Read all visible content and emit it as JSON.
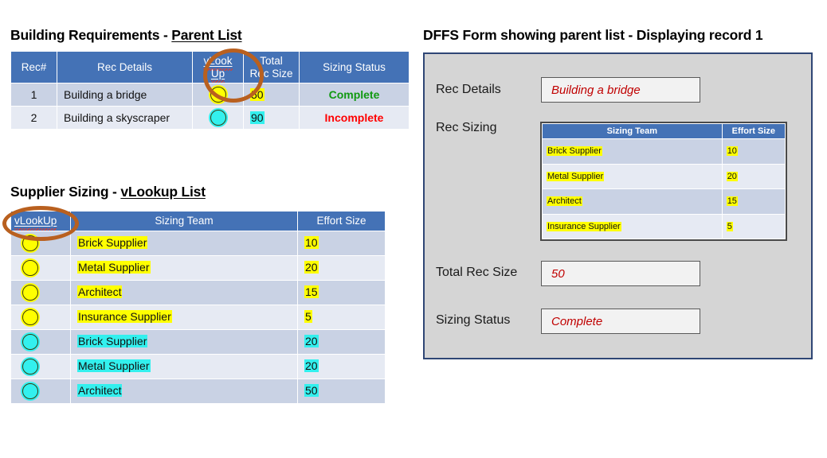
{
  "left": {
    "parent": {
      "title_plain": "Building Requirements - ",
      "title_underlined": "Parent List",
      "title_full": "Building Requirements - Parent List",
      "columns": [
        "Rec#",
        "Rec Details",
        "vLook Up",
        "Total Rec Size",
        "Sizing Status"
      ],
      "col_vlookup_line1": "vLook",
      "col_vlookup_line2": "Up",
      "col_total_line1": "Total",
      "col_total_line2": "Rec Size",
      "rows": [
        {
          "rec": "1",
          "details": "Building a bridge",
          "marker": "circle-yellow",
          "size": "50",
          "size_hl": "yellow",
          "status": "Complete",
          "status_kind": "complete"
        },
        {
          "rec": "2",
          "details": "Building a skyscraper",
          "marker": "circle-cyan",
          "size": "90",
          "size_hl": "cyan",
          "status": "Incomplete",
          "status_kind": "incomplete"
        }
      ]
    },
    "supplier": {
      "title_plain": "Supplier Sizing - ",
      "title_underlined": "vLookup List",
      "title_full": "Supplier Sizing - vLookup List",
      "columns": [
        "vLookUp",
        "Sizing Team",
        "Effort Size"
      ],
      "rows": [
        {
          "marker": "circle-yellow",
          "team": "Brick Supplier",
          "team_hl": "yellow",
          "effort": "10",
          "effort_hl": "yellow"
        },
        {
          "marker": "circle-yellow",
          "team": "Metal Supplier",
          "team_hl": "yellow",
          "effort": "20",
          "effort_hl": "yellow"
        },
        {
          "marker": "circle-yellow",
          "team": "Architect",
          "team_hl": "yellow",
          "effort": "15",
          "effort_hl": "yellow"
        },
        {
          "marker": "circle-yellow",
          "team": "Insurance Supplier",
          "team_hl": "yellow",
          "effort": "5",
          "effort_hl": "yellow"
        },
        {
          "marker": "circle-cyan",
          "team": "Brick Supplier",
          "team_hl": "cyan",
          "effort": "20",
          "effort_hl": "cyan"
        },
        {
          "marker": "circle-cyan",
          "team": "Metal Supplier",
          "team_hl": "cyan",
          "effort": "20",
          "effort_hl": "cyan"
        },
        {
          "marker": "circle-cyan",
          "team": "Architect",
          "team_hl": "cyan",
          "effort": "50",
          "effort_hl": "cyan"
        }
      ]
    }
  },
  "right": {
    "title": "DFFS Form showing parent list - Displaying record 1",
    "labels": {
      "rec_details": "Rec Details",
      "rec_sizing": "Rec Sizing",
      "total_rec_size": "Total Rec Size",
      "sizing_status": "Sizing Status"
    },
    "fields": {
      "rec_details_value": "Building a bridge",
      "total_rec_size_value": "50",
      "sizing_status_value": "Complete"
    },
    "sizing_table": {
      "columns": [
        "Sizing Team",
        "Effort Size"
      ],
      "rows": [
        {
          "team": "Brick Supplier",
          "effort": "10"
        },
        {
          "team": "Metal Supplier",
          "effort": "20"
        },
        {
          "team": "Architect",
          "effort": "15"
        },
        {
          "team": "Insurance Supplier",
          "effort": "5"
        }
      ]
    }
  },
  "annotations": {
    "ellipse_parent_vlookup": "highlight-vlookup-column-header",
    "ellipse_supplier_vlookup": "highlight-vlookup-key-column-header"
  },
  "colors": {
    "header_blue": "#4472b6",
    "row_band_dark": "#c9d2e4",
    "row_band_light": "#e6eaf3",
    "highlight_yellow": "#ffff00",
    "highlight_cyan": "#33f0ee",
    "status_complete": "#119911",
    "status_incomplete": "#ff0000",
    "annotation_orange": "#b9601f",
    "form_background": "#d5d5d5",
    "form_border": "#2f4675",
    "field_text_red": "#c00000"
  }
}
